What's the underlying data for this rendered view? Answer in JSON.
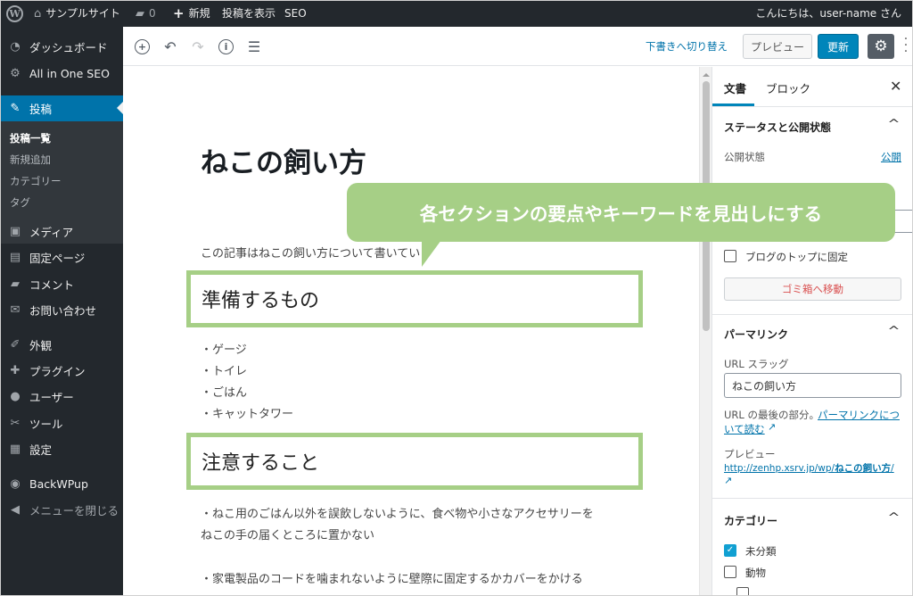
{
  "adminbar": {
    "site_name": "サンプルサイト",
    "comments_count": "0",
    "new_label": "新規",
    "view_post_label": "投稿を表示",
    "seo_label": "SEO",
    "greeting": "こんにちは、user-name さん"
  },
  "sidebar": {
    "items": [
      {
        "label": "ダッシュボード",
        "icon": "dashboard-icon"
      },
      {
        "label": "All in One SEO",
        "icon": "gear-icon"
      },
      {
        "label": "投稿",
        "icon": "pin-icon"
      },
      {
        "label": "メディア",
        "icon": "media-icon"
      },
      {
        "label": "固定ページ",
        "icon": "page-icon"
      },
      {
        "label": "コメント",
        "icon": "comment-icon"
      },
      {
        "label": "お問い合わせ",
        "icon": "mail-icon"
      },
      {
        "label": "外観",
        "icon": "brush-icon"
      },
      {
        "label": "プラグイン",
        "icon": "plugin-icon"
      },
      {
        "label": "ユーザー",
        "icon": "user-icon"
      },
      {
        "label": "ツール",
        "icon": "wrench-icon"
      },
      {
        "label": "設定",
        "icon": "settings-icon"
      },
      {
        "label": "BackWPup",
        "icon": "backwpup-icon"
      },
      {
        "label": "メニューを閉じる",
        "icon": "collapse-icon"
      }
    ],
    "submenu": [
      "投稿一覧",
      "新規追加",
      "カテゴリー",
      "タグ"
    ]
  },
  "toolbar": {
    "switch_to_draft": "下書きへ切り替え",
    "preview": "プレビュー",
    "update": "更新"
  },
  "post": {
    "title": "ねこの飼い方",
    "intro": "この記事はねこの飼い方について書いてい",
    "heading1": "準備するもの",
    "list": [
      "・ゲージ",
      "・トイレ",
      "・ごはん",
      "・キャットタワー"
    ],
    "heading2": "注意すること",
    "para1_line1": "・ねこ用のごはん以外を誤飲しないように、食べ物や小さなアクセサリーを",
    "para1_line2": "ねこの手の届くところに置かない",
    "para2": "・家電製品のコードを噛まれないように壁際に固定するかカバーをかける"
  },
  "callout": {
    "text": "各セクションの要点やキーワードを見出しにする"
  },
  "panel": {
    "tab_document": "文書",
    "tab_block": "ブロック",
    "status_title": "ステータスと公開状態",
    "visibility_label": "公開状態",
    "visibility_value": "公開",
    "sticky_label": "ブログのトップに固定",
    "trash_label": "ゴミ箱へ移動",
    "permalink_title": "パーマリンク",
    "url_slug_label": "URL スラッグ",
    "url_slug_value": "ねこの飼い方",
    "url_note": "URL の最後の部分。",
    "permalink_link_1": "パーマリンクにつ",
    "permalink_link_2": "いて読む",
    "preview_label": "プレビュー",
    "preview_url_prefix": "http://zenhp.xsrv.jp/wp/",
    "preview_url_slug": "ねこの飼い方",
    "preview_url_suffix": "/",
    "categories_title": "カテゴリー",
    "categories": [
      {
        "label": "未分類",
        "checked": true
      },
      {
        "label": "動物",
        "checked": false
      }
    ]
  },
  "colors": {
    "admin_dark": "#23282d",
    "active_blue": "#0073aa",
    "callout_green": "#a6cf86"
  }
}
